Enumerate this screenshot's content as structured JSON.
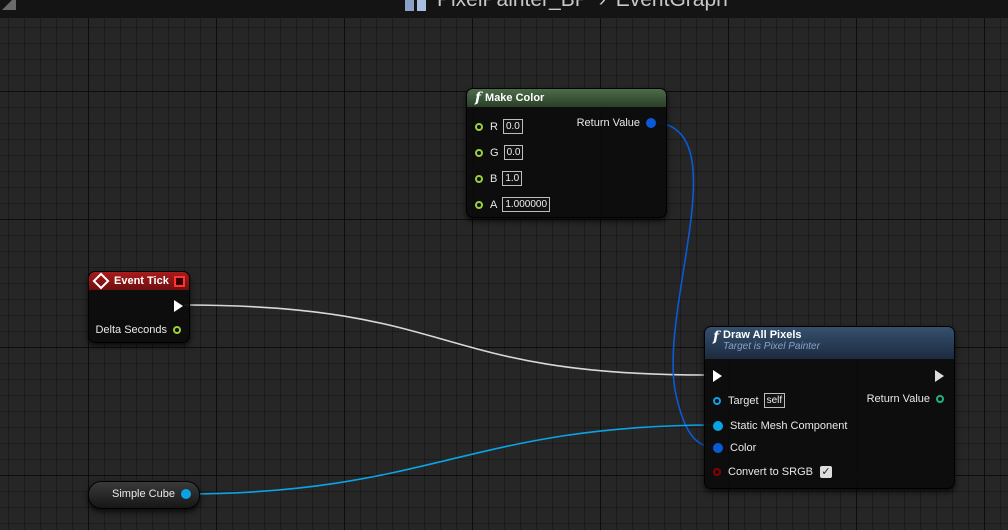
{
  "breadcrumb": {
    "blueprint": "PixelPainter_BP",
    "separator": "›",
    "graph": "EventGraph"
  },
  "nodes": {
    "make_color": {
      "title": "Make Color",
      "icon": "function-icon",
      "inputs": [
        {
          "name": "R",
          "value": "0.0"
        },
        {
          "name": "G",
          "value": "0.0"
        },
        {
          "name": "B",
          "value": "1.0"
        },
        {
          "name": "A",
          "value": "1.000000"
        }
      ],
      "output": "Return Value"
    },
    "event_tick": {
      "title": "Event Tick",
      "icon": "event-icon",
      "output": "Delta Seconds"
    },
    "simple_cube": {
      "label": "Simple Cube"
    },
    "draw_all_pixels": {
      "title": "Draw All Pixels",
      "subtitle": "Target is Pixel Painter",
      "icon": "function-icon",
      "target_label": "Target",
      "target_value": "self",
      "return_label": "Return Value",
      "static_mesh_label": "Static Mesh Component",
      "color_label": "Color",
      "srgb_label": "Convert to SRGB",
      "srgb_checked": true
    }
  },
  "colors": {
    "float_pin": "#9ccf3c",
    "struct_pin": "#0a5ad6",
    "object_pin": "#0aa4e6",
    "bool_pin": "#8a0000",
    "make_color_header": "#3d5a3a",
    "event_header": "#8a1414",
    "draw_header": "#2a3f5a"
  }
}
